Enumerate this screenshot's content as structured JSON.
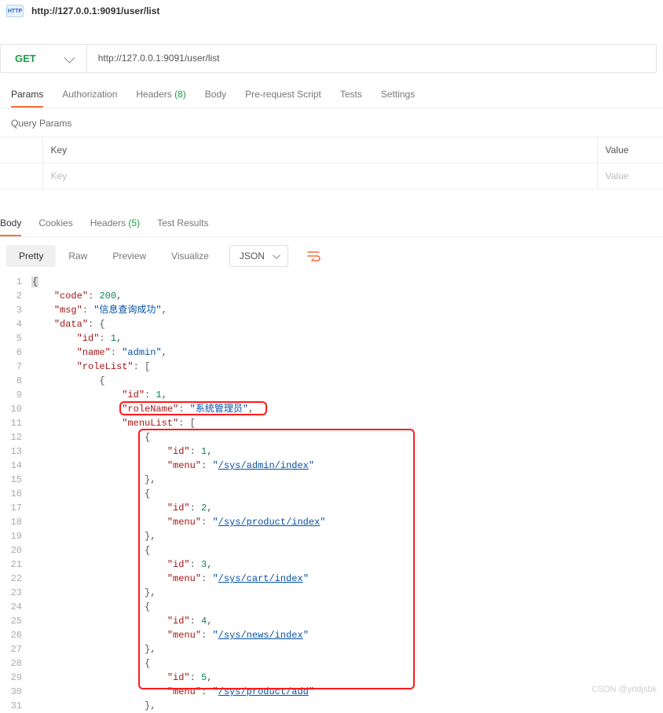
{
  "header": {
    "title": "http://127.0.0.1:9091/user/list"
  },
  "request": {
    "method": "GET",
    "url": "http://127.0.0.1:9091/user/list"
  },
  "reqTabs": {
    "params": "Params",
    "auth": "Authorization",
    "headers_l": "Headers ",
    "headers_c": "(8)",
    "body": "Body",
    "prereq": "Pre-request Script",
    "tests": "Tests",
    "settings": "Settings"
  },
  "section": {
    "queryParams": "Query Params"
  },
  "qp": {
    "keyH": "Key",
    "valH": "Value",
    "keyPH": "Key",
    "valPH": "Value"
  },
  "respTabs": {
    "body": "Body",
    "cookies": "Cookies",
    "headers_l": "Headers ",
    "headers_c": "(5)",
    "tests": "Test Results"
  },
  "views": {
    "pretty": "Pretty",
    "raw": "Raw",
    "preview": "Preview",
    "visualize": "Visualize",
    "fmt": "JSON"
  },
  "code": {
    "l1": "{",
    "l2a": "\"code\"",
    "l2b": ": ",
    "l2c": "200",
    "l2d": ",",
    "l3a": "\"msg\"",
    "l3b": ": ",
    "l3c": "\"信息查询成功\"",
    "l3d": ",",
    "l4a": "\"data\"",
    "l4b": ": {",
    "l5a": "\"id\"",
    "l5b": ": ",
    "l5c": "1",
    "l5d": ",",
    "l6a": "\"name\"",
    "l6b": ": ",
    "l6c": "\"admin\"",
    "l6d": ",",
    "l7a": "\"roleList\"",
    "l7b": ": [",
    "l8": "{",
    "l9a": "\"id\"",
    "l9b": ": ",
    "l9c": "1",
    "l9d": ",",
    "l10a": "\"roleName\"",
    "l10b": ": ",
    "l10c": "\"系统管理员\"",
    "l10d": ",",
    "l11a": "\"menuList\"",
    "l11b": ": [",
    "l12": "{",
    "l13a": "\"id\"",
    "l13b": ": ",
    "l13c": "1",
    "l13d": ",",
    "l14a": "\"menu\"",
    "l14b": ": ",
    "l14c": "\"",
    "l14d": "/sys/admin/index",
    "l14e": "\"",
    "l15": "},",
    "l16": "{",
    "l17a": "\"id\"",
    "l17b": ": ",
    "l17c": "2",
    "l17d": ",",
    "l18a": "\"menu\"",
    "l18b": ": ",
    "l18c": "\"",
    "l18d": "/sys/product/index",
    "l18e": "\"",
    "l19": "},",
    "l20": "{",
    "l21a": "\"id\"",
    "l21b": ": ",
    "l21c": "3",
    "l21d": ",",
    "l22a": "\"menu\"",
    "l22b": ": ",
    "l22c": "\"",
    "l22d": "/sys/cart/index",
    "l22e": "\"",
    "l23": "},",
    "l24": "{",
    "l25a": "\"id\"",
    "l25b": ": ",
    "l25c": "4",
    "l25d": ",",
    "l26a": "\"menu\"",
    "l26b": ": ",
    "l26c": "\"",
    "l26d": "/sys/news/index",
    "l26e": "\"",
    "l27": "},",
    "l28": "{",
    "l29a": "\"id\"",
    "l29b": ": ",
    "l29c": "5",
    "l29d": ",",
    "l30a": "\"menu\"",
    "l30b": ": ",
    "l30c": "\"",
    "l30d": "/sys/product/add",
    "l30e": "\"",
    "l31": "},"
  },
  "watermark": "CSDN @yrldjsbk"
}
